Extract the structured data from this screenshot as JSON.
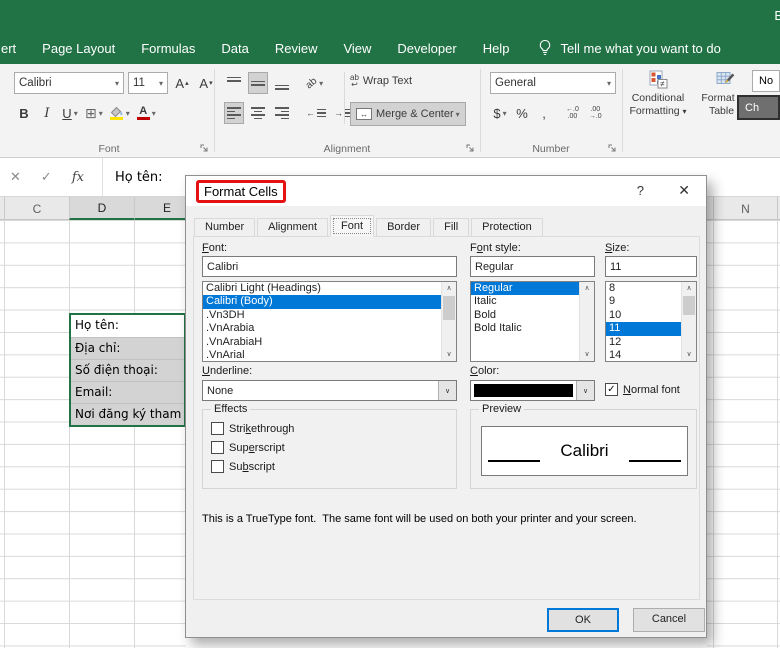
{
  "icons": {
    "dropdown": "▾",
    "combo_arrow": "∨",
    "scroll_up": "∧",
    "scroll_down": "∨",
    "check": "✓",
    "cancel_x": "✕",
    "enter_check": "✓",
    "up_triangle": "▴",
    "down_triangle": "▾",
    "wrap_ab": "ab",
    "wrap_arrow": "↩",
    "merge_arrows": "↔",
    "orientation_ab": "ab",
    "indent_left_arrow": "←",
    "indent_right_arrow": "→",
    "inc_decimal_top": "←.0",
    "inc_decimal_bottom": ".00",
    "dec_decimal_top": ".00",
    "dec_decimal_bottom": "→.0"
  },
  "app": {
    "account_partial": "B",
    "ribbon_tabs": [
      "ert",
      "Page Layout",
      "Formulas",
      "Data",
      "Review",
      "View",
      "Developer",
      "Help"
    ],
    "tell_me": "Tell me what you want to do",
    "accent_green": "#217346"
  },
  "ribbon": {
    "font": {
      "group_label": "Font",
      "font_name": "Calibri",
      "font_size": "11",
      "bold": "B",
      "italic": "I",
      "underline": "U",
      "fill_color": "#ffe400",
      "font_color_letter": "A",
      "font_color": "#c00000"
    },
    "alignment": {
      "group_label": "Alignment",
      "wrap_text": "Wrap Text",
      "merge_center": "Merge & Center"
    },
    "number": {
      "group_label": "Number",
      "format": "General",
      "currency": "$",
      "percent": "%",
      "comma": ","
    },
    "styles": {
      "conditional_line1": "Conditional",
      "conditional_line2": "Formatting",
      "format_table_line1": "Format as",
      "format_table_line2": "Table",
      "style_normal_partial": "No",
      "style_check_partial": "Ch"
    }
  },
  "formula_bar": {
    "fx": "fx",
    "value": "Họ tên:"
  },
  "sheet": {
    "columns_left": [
      "C",
      "D",
      "E"
    ],
    "column_right": "N",
    "cells": [
      "Họ tên:",
      "Địa chỉ:",
      "Số điện thoại:",
      "Email:",
      "Nơi đăng ký tham"
    ]
  },
  "dialog": {
    "title": "Format Cells",
    "help_glyph": "?",
    "close_glyph": "✕",
    "tabs": [
      "Number",
      "Alignment",
      "Font",
      "Border",
      "Fill",
      "Protection"
    ],
    "active_tab": "Font",
    "font": {
      "label": "Font:",
      "value": "Calibri",
      "list": [
        "Calibri Light (Headings)",
        "Calibri (Body)",
        ".Vn3DH",
        ".VnArabia",
        ".VnArabiaH",
        ".VnArial"
      ],
      "selected": "Calibri (Body)"
    },
    "font_style": {
      "label": "Font style:",
      "value": "Regular",
      "list": [
        "Regular",
        "Italic",
        "Bold",
        "Bold Italic"
      ],
      "selected": "Regular"
    },
    "size": {
      "label": "Size:",
      "value": "11",
      "list": [
        "8",
        "9",
        "10",
        "11",
        "12",
        "14"
      ],
      "selected": "11"
    },
    "underline": {
      "label": "Underline:",
      "value": "None"
    },
    "color": {
      "label": "Color:",
      "value_hex": "#000000"
    },
    "normal_font": {
      "label": "Normal font",
      "checked": true
    },
    "effects": {
      "label": "Effects",
      "options": [
        "Strikethrough",
        "Superscript",
        "Subscript"
      ]
    },
    "preview": {
      "label": "Preview",
      "text": "Calibri"
    },
    "note": "This is a TrueType font.  The same font will be used on both your printer and your screen.",
    "ok": "OK",
    "cancel": "Cancel",
    "selection_blue": "#0078d7"
  }
}
